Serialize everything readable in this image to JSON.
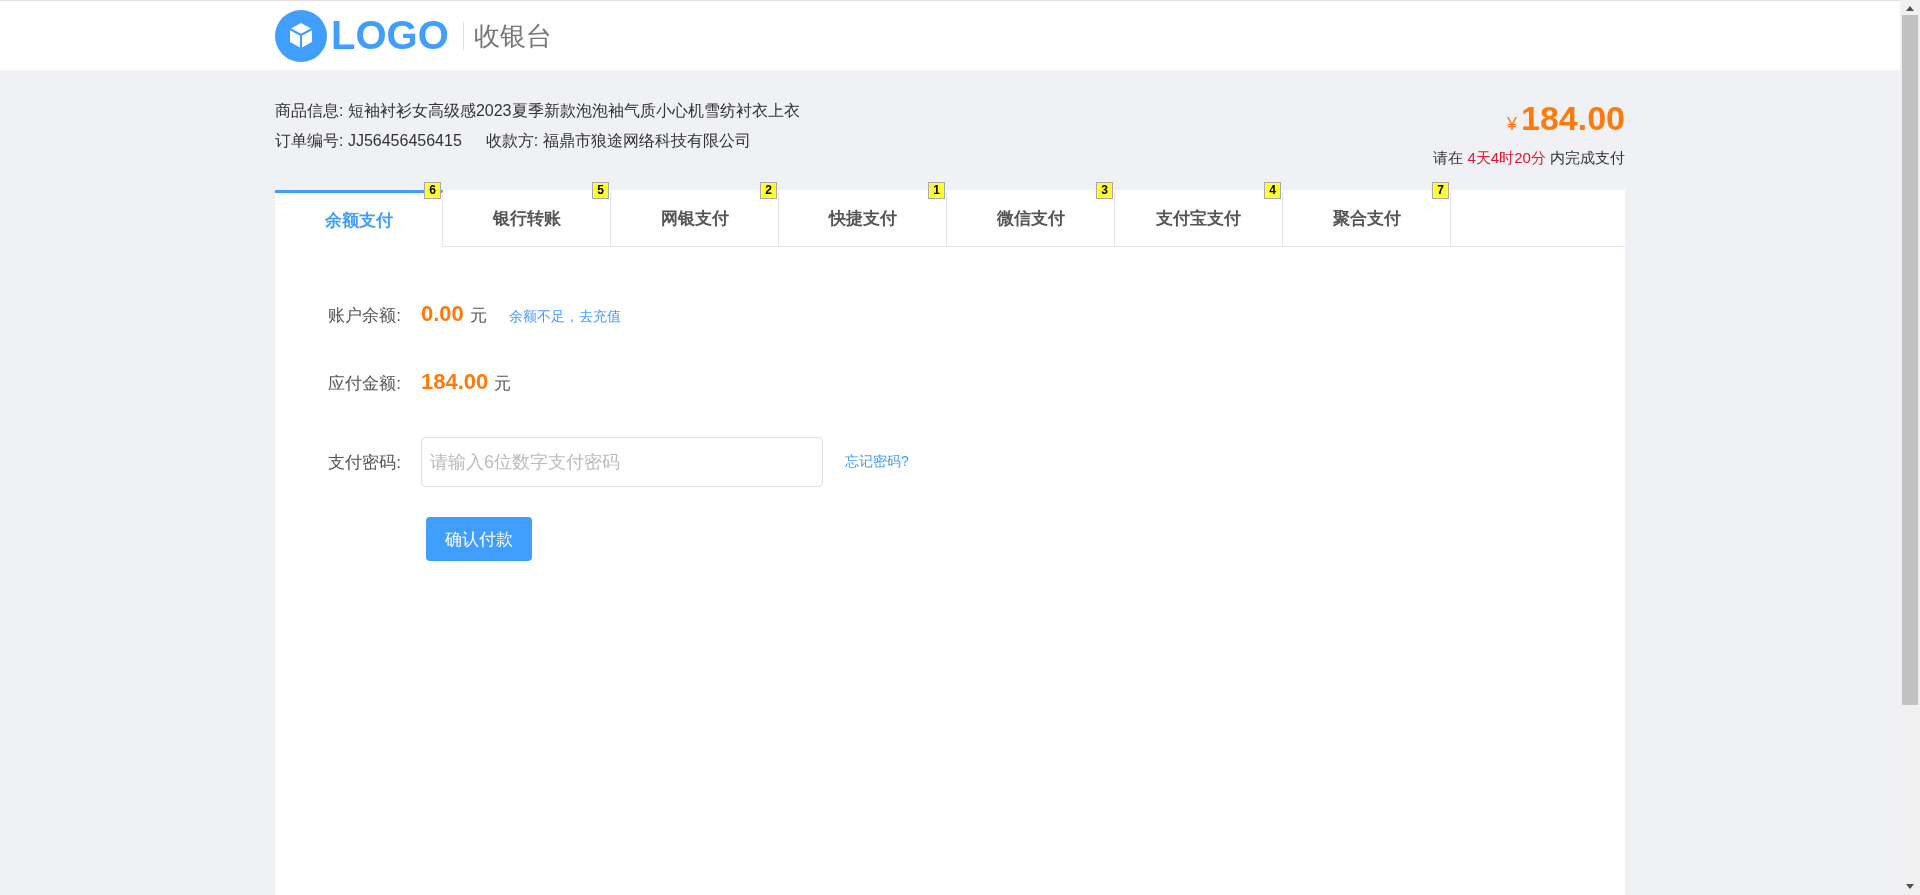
{
  "header": {
    "logo": "LOGO",
    "title": "收银台"
  },
  "order": {
    "product_label": "商品信息:",
    "product": "短袖衬衫女高级感2023夏季新款泡泡袖气质小心机雪纺衬衣上衣",
    "order_no_label": "订单编号:",
    "order_no": "JJ56456456415",
    "payee_label": "收款方:",
    "payee": "福鼎市狼途网络科技有限公司",
    "currency": "¥",
    "amount": "184.00",
    "deadline_prefix": "请在",
    "deadline": "4天4时20分",
    "deadline_suffix": "内完成支付"
  },
  "tabs": [
    {
      "label": "余额支付",
      "badge": "6",
      "selected": true
    },
    {
      "label": "银行转账",
      "badge": "5",
      "selected": false
    },
    {
      "label": "网银支付",
      "badge": "2",
      "selected": false
    },
    {
      "label": "快捷支付",
      "badge": "1",
      "selected": false
    },
    {
      "label": "微信支付",
      "badge": "3",
      "selected": false
    },
    {
      "label": "支付宝支付",
      "badge": "4",
      "selected": false
    },
    {
      "label": "聚合支付",
      "badge": "7",
      "selected": false
    }
  ],
  "form": {
    "balance_label": "账户余额:",
    "balance": "0.00",
    "balance_unit": "元",
    "recharge_link": "余额不足，去充值",
    "due_label": "应付金额:",
    "due": "184.00",
    "due_unit": "元",
    "password_label": "支付密码:",
    "password_placeholder": "请输入6位数字支付密码",
    "forgot_link": "忘记密码?",
    "confirm_button": "确认付款"
  }
}
